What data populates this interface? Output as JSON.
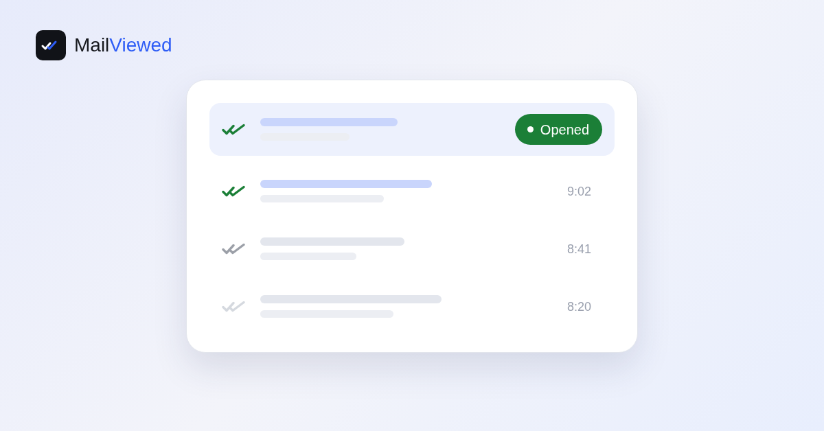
{
  "brand": {
    "name": "Mail",
    "accent": "Viewed"
  },
  "messages": [
    {
      "selected": true,
      "opened": true,
      "color": "#1b7f37",
      "status": "Opened"
    },
    {
      "selected": false,
      "opened": true,
      "color": "#1b7f37",
      "time": "9:02"
    },
    {
      "selected": false,
      "opened": false,
      "color": "#9ca0a8",
      "time": "8:41"
    },
    {
      "selected": false,
      "opened": false,
      "color": "#d5d9df",
      "time": "8:20"
    }
  ]
}
